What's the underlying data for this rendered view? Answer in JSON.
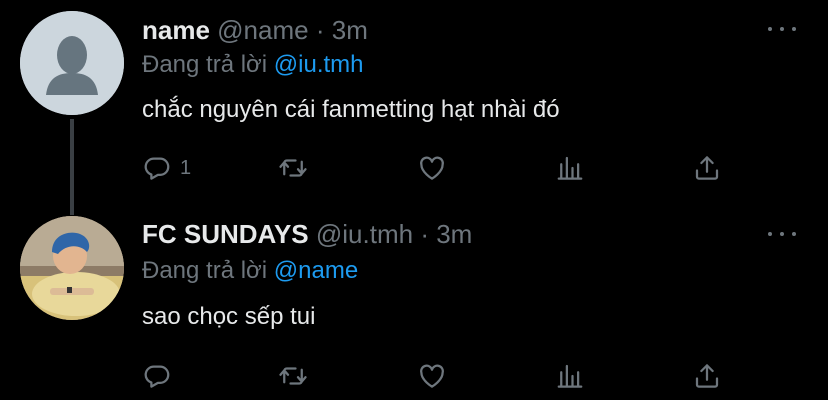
{
  "tweets": [
    {
      "display_name": "name",
      "handle": "@name",
      "separator": "·",
      "time": "3m",
      "reply_prefix": "Đang trả lời",
      "reply_to": "@iu.tmh",
      "text": "chắc nguyên cái fanmetting hạt nhài đó",
      "reply_count": "1",
      "avatar": "default-avatar"
    },
    {
      "display_name": "FC SUNDAYS",
      "handle": "@iu.tmh",
      "separator": "·",
      "time": "3m",
      "reply_prefix": "Đang trả lời",
      "reply_to": "@name",
      "text": "sao chọc sếp tui",
      "reply_count": "",
      "avatar": "photo-avatar"
    }
  ],
  "colors": {
    "background": "#000000",
    "text": "#e7e9ea",
    "muted": "#6e767d",
    "accent": "#1d9bf0"
  },
  "icons": [
    "reply-icon",
    "retweet-icon",
    "like-icon",
    "analytics-icon",
    "share-icon",
    "more-icon"
  ]
}
